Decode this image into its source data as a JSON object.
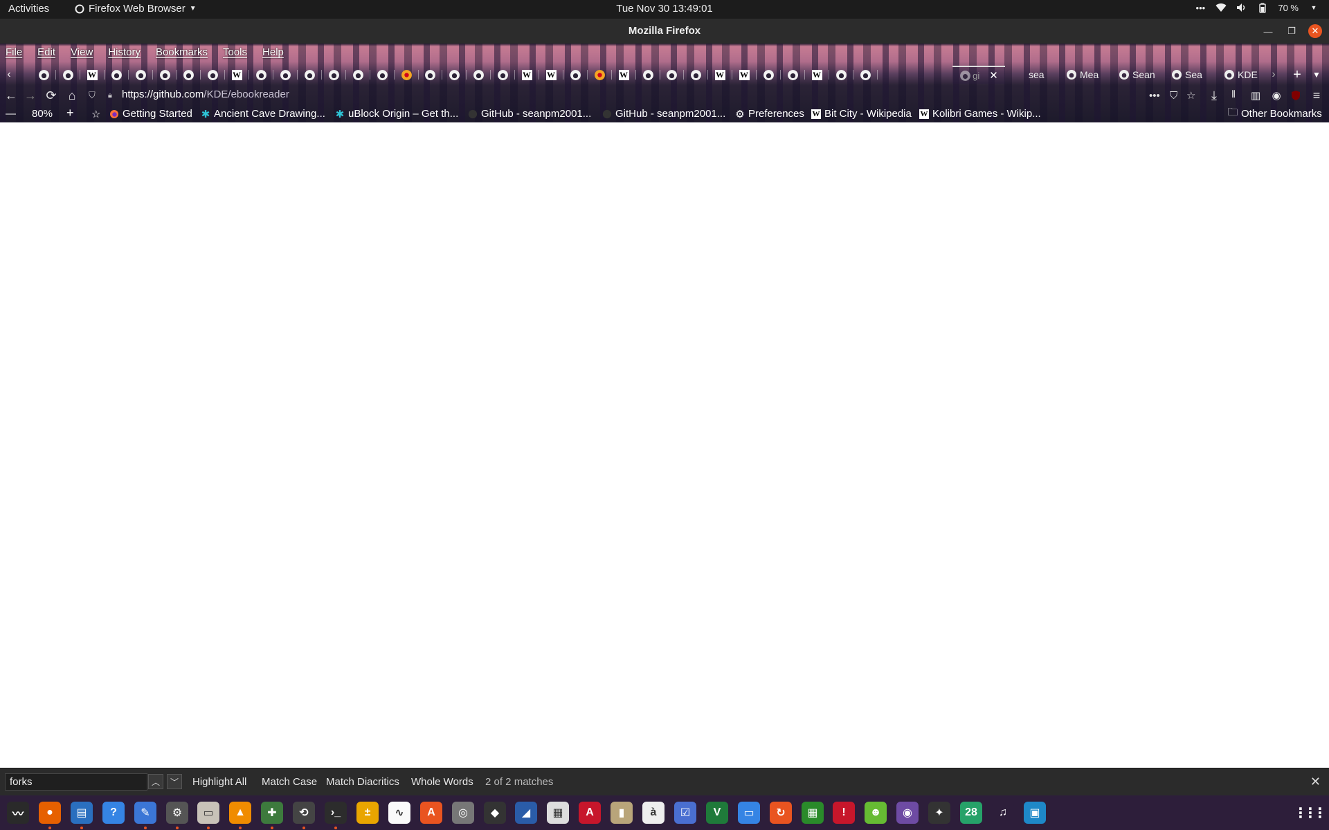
{
  "topbar": {
    "activities": "Activities",
    "app_name": "Firefox Web Browser",
    "clock": "Tue Nov 30  13:49:01",
    "battery": "70 %"
  },
  "window": {
    "title": "Mozilla Firefox"
  },
  "menubar": {
    "file": "File",
    "edit": "Edit",
    "view": "View",
    "history": "History",
    "bookmarks": "Bookmarks",
    "tools": "Tools",
    "help": "Help"
  },
  "tabs": {
    "active_title": "gi",
    "partial_tabs": [
      "sea",
      "Mea",
      "Sean",
      "Sea",
      "KDE"
    ]
  },
  "navbar": {
    "url_host": "https://github.com",
    "url_path": "/KDE/ebookreader"
  },
  "bookmarks_bar": {
    "zoom": "80%",
    "items": [
      "Getting Started",
      "Ancient Cave Drawing...",
      "uBlock Origin – Get th...",
      "GitHub - seanpm2001...",
      "GitHub - seanpm2001...",
      "Preferences",
      "Bit City - Wikipedia",
      "Kolibri Games - Wikip..."
    ],
    "other": "Other Bookmarks"
  },
  "findbar": {
    "query": "forks",
    "highlight_all": "Highlight All",
    "match_case": "Match Case",
    "match_diacritics": "Match Diacritics",
    "whole_words": "Whole Words",
    "status": "2 of 2 matches"
  },
  "dock": {
    "calendar_day": "28"
  },
  "colors": {
    "accent": "#e95420",
    "topbar": "#1c1c1c",
    "dock": "#2d1e3a"
  }
}
